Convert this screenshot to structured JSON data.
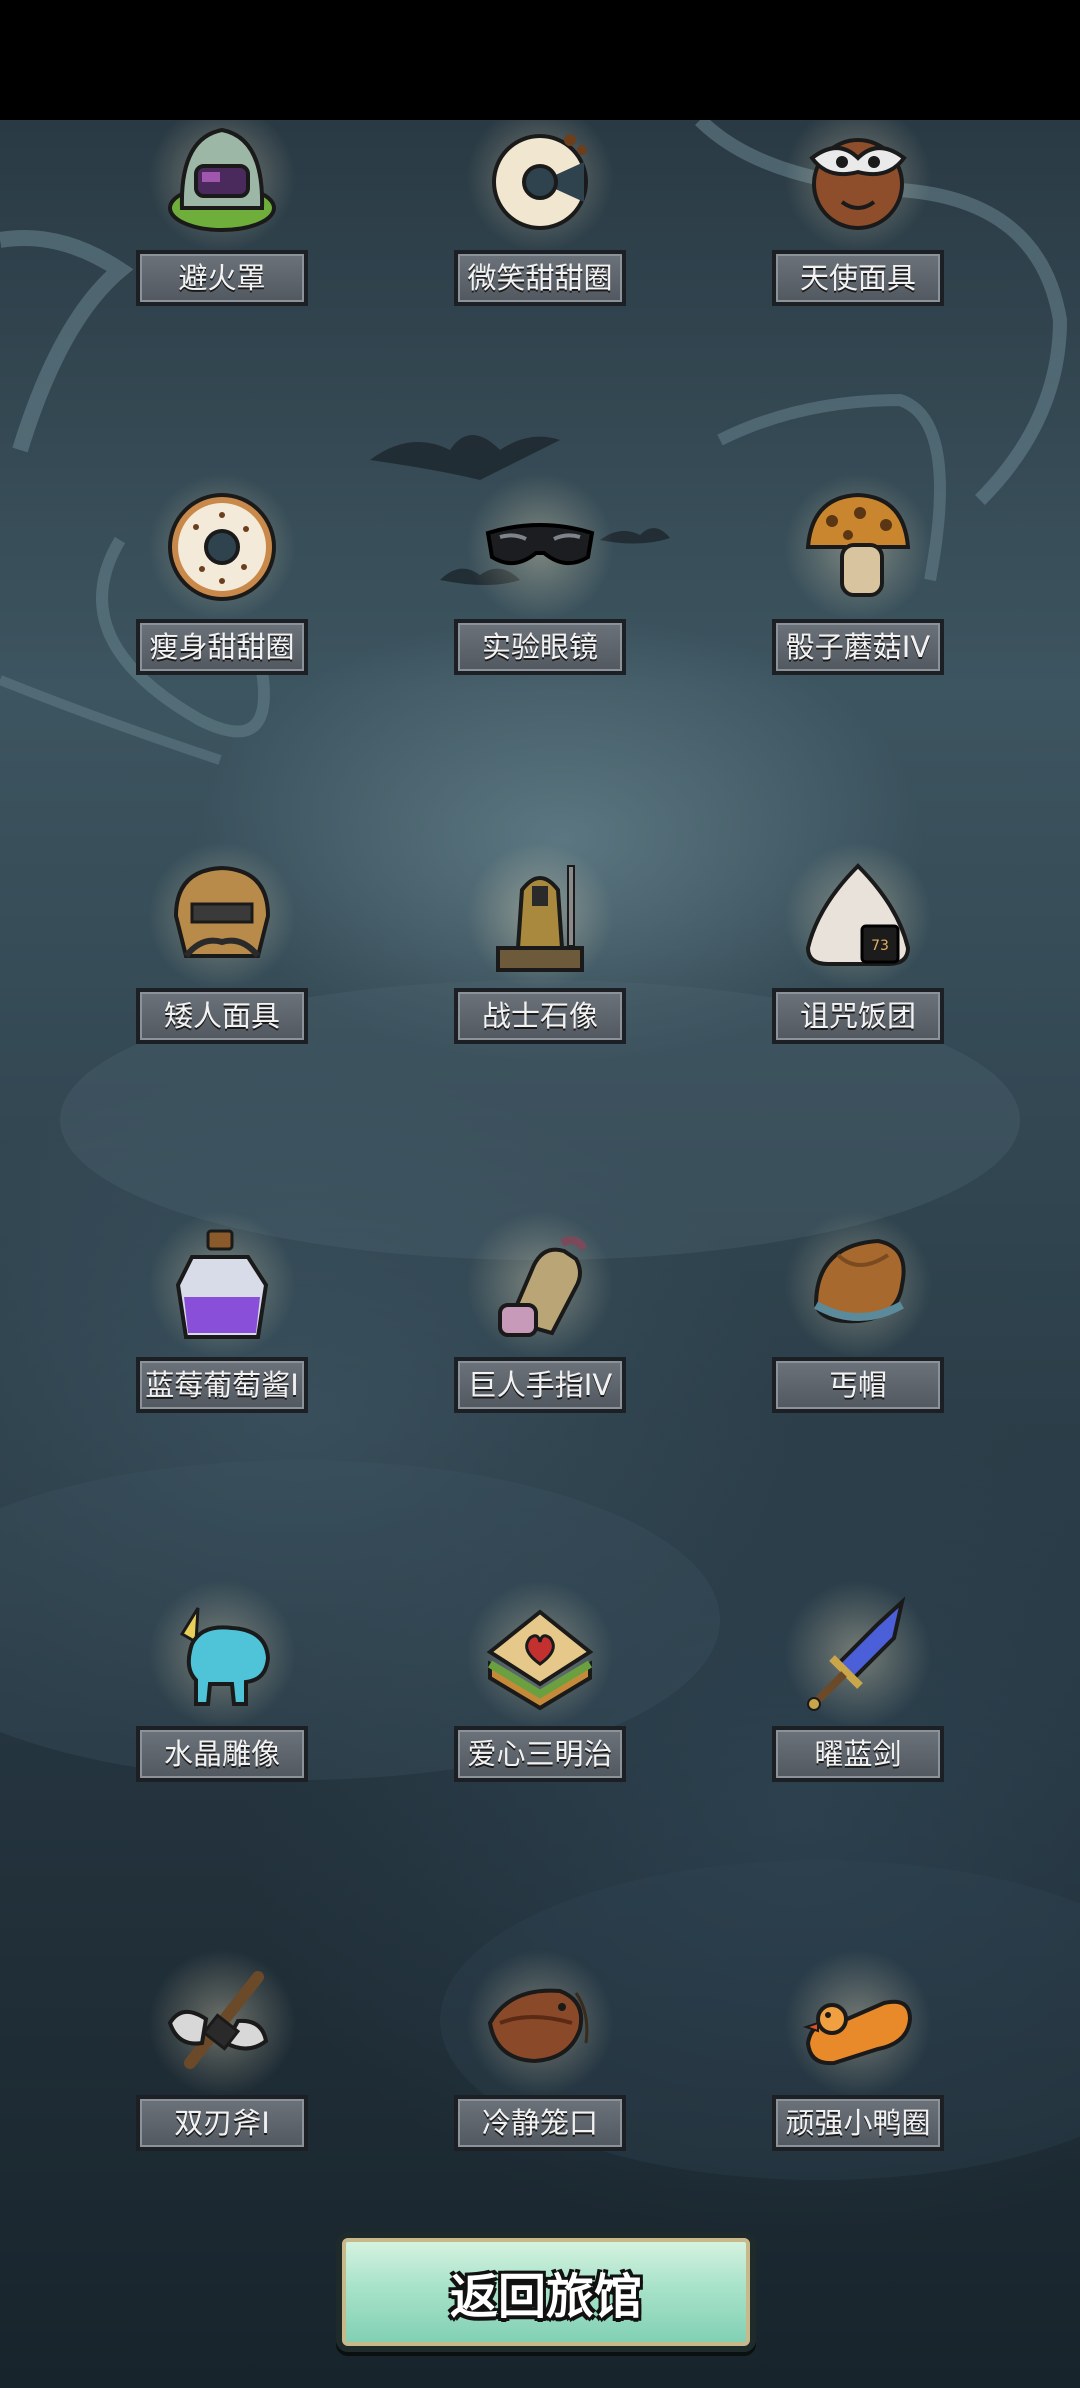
{
  "items": [
    {
      "label": "避火罩",
      "icon": "fire-mask-icon"
    },
    {
      "label": "微笑甜甜圈",
      "icon": "smile-donut-icon"
    },
    {
      "label": "天使面具",
      "icon": "angel-mask-icon"
    },
    {
      "label": "瘦身甜甜圈",
      "icon": "slim-donut-icon"
    },
    {
      "label": "实验眼镜",
      "icon": "lab-glasses-icon"
    },
    {
      "label": "骰子蘑菇IV",
      "icon": "dice-mushroom-icon"
    },
    {
      "label": "矮人面具",
      "icon": "dwarf-mask-icon"
    },
    {
      "label": "战士石像",
      "icon": "warrior-statue-icon"
    },
    {
      "label": "诅咒饭团",
      "icon": "cursed-riceball-icon"
    },
    {
      "label": "蓝莓葡萄酱I",
      "icon": "blueberry-jam-icon"
    },
    {
      "label": "巨人手指IV",
      "icon": "giant-finger-icon"
    },
    {
      "label": "丐帽",
      "icon": "beggar-hat-icon"
    },
    {
      "label": "水晶雕像",
      "icon": "crystal-statue-icon"
    },
    {
      "label": "爱心三明治",
      "icon": "heart-sandwich-icon"
    },
    {
      "label": "曜蓝剑",
      "icon": "blue-sword-icon"
    },
    {
      "label": "双刃斧I",
      "icon": "double-axe-icon"
    },
    {
      "label": "冷静笼口",
      "icon": "muzzle-icon"
    },
    {
      "label": "顽强小鸭圈",
      "icon": "duck-ring-icon"
    }
  ],
  "return_button": {
    "label": "返回旅馆"
  },
  "colors": {
    "label_bg": "#5e646b",
    "button_bg": "#a8e3c9"
  }
}
